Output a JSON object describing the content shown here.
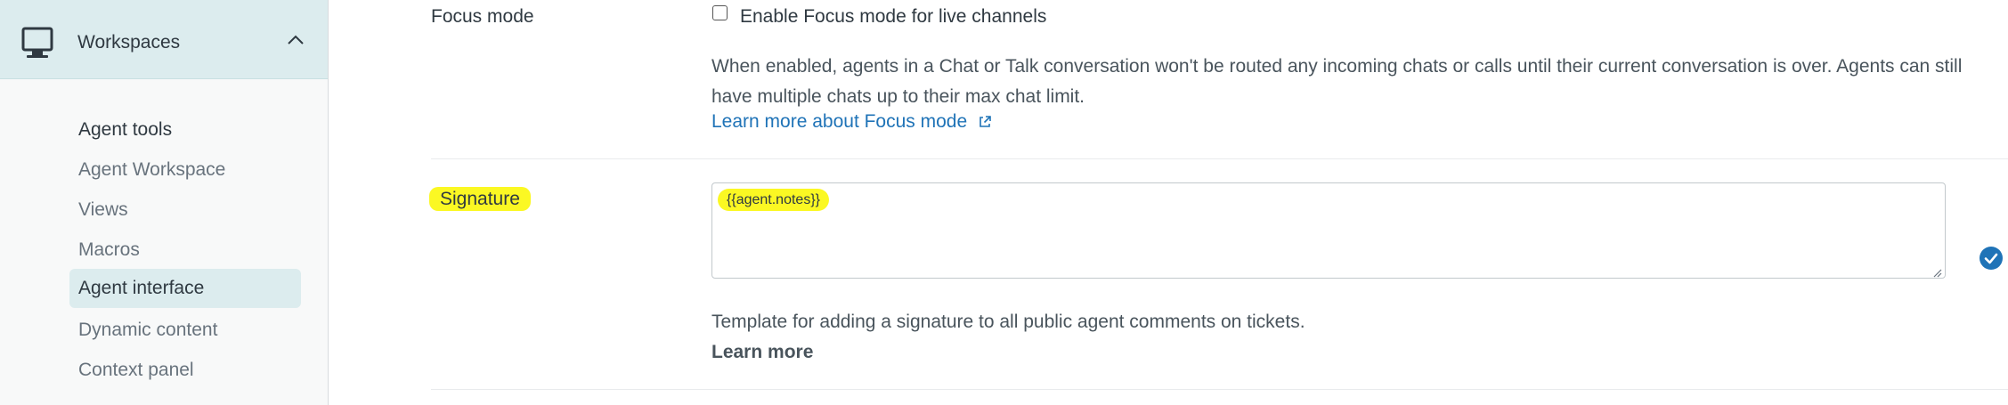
{
  "sidebar": {
    "workspaces_label": "Workspaces",
    "section_title": "Agent tools",
    "items": [
      {
        "label": "Agent Workspace",
        "active": false
      },
      {
        "label": "Views",
        "active": false
      },
      {
        "label": "Macros",
        "active": false
      },
      {
        "label": "Agent interface",
        "active": true
      },
      {
        "label": "Dynamic content",
        "active": false
      },
      {
        "label": "Context panel",
        "active": false
      }
    ]
  },
  "focus_mode": {
    "label": "Focus mode",
    "checkbox_label": "Enable Focus mode for live channels",
    "checked": false,
    "description": "When enabled, agents in a Chat or Talk conversation won't be routed any incoming chats or calls until their current conversation is over. Agents can still have multiple chats up to their max chat limit.",
    "learn_more": "Learn more about Focus mode"
  },
  "signature": {
    "label": "Signature",
    "value": "{{agent.notes}}",
    "hint": "Template for adding a signature to all public agent comments on tickets.",
    "learn_more": "Learn more"
  },
  "colors": {
    "sidebar_active": "#dcecee",
    "highlight": "#fbf823",
    "link": "#1f73b7",
    "check_badge": "#1f73b7"
  }
}
